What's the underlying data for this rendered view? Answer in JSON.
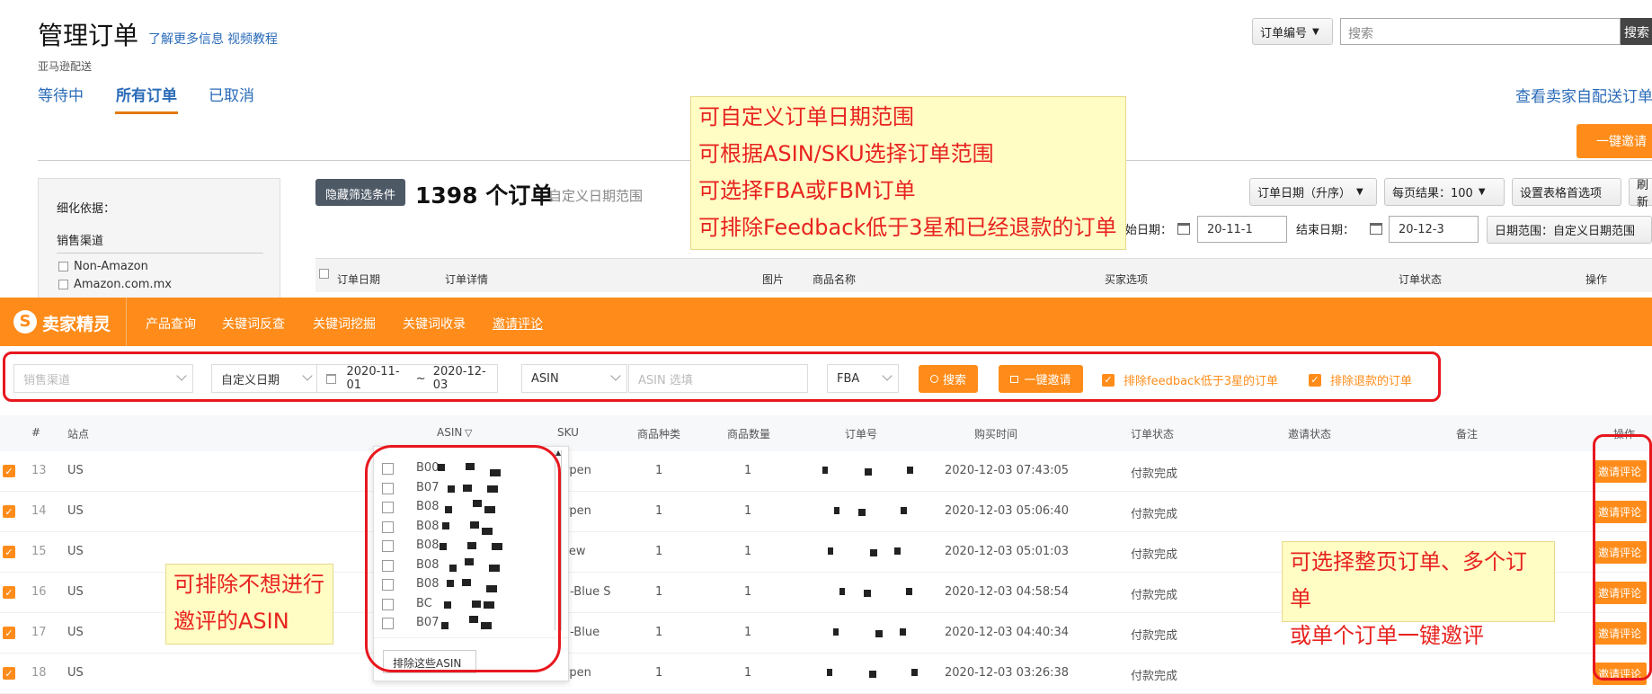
{
  "header": {
    "title": "管理订单",
    "link_more": "了解更多信息",
    "link_video": "视频教程",
    "subtitle": "亚马逊配送",
    "search_select": "订单编号",
    "search_placeholder": "搜索",
    "search_btn": "搜索",
    "seller_link": "查看卖家自配送订单",
    "one_click": "一键邀请"
  },
  "tabs": [
    {
      "label": "等待中"
    },
    {
      "label": "所有订单",
      "active": true
    },
    {
      "label": "已取消"
    }
  ],
  "sidebar": {
    "refine": "细化依据：",
    "channel": "销售渠道",
    "opt1": "Non-Amazon",
    "opt2": "Amazon.com.mx"
  },
  "toolbar": {
    "hide_filter": "隐藏筛选条件",
    "order_count": "1398 个订单",
    "date_range_hint": "自定义日期范围",
    "sort": "订单日期（升序）",
    "per_page": "每页结果：100",
    "table_pref": "设置表格首选项",
    "refresh": "刷新",
    "start_label": "始日期：",
    "start_date": "20-11-1",
    "end_label": "结束日期：",
    "end_date": "20-12-3",
    "range": "日期范围：自定义日期范围"
  },
  "amz_table_head": [
    "订单日期",
    "订单详情",
    "图片",
    "商品名称",
    "买家选项",
    "订单状态",
    "操作"
  ],
  "plugin": {
    "logo": "卖家精灵",
    "nav": [
      "产品查询",
      "关键词反查",
      "关键词挖掘",
      "关键词收录",
      "邀请评论"
    ],
    "channel_ph": "销售渠道",
    "date_type": "自定义日期",
    "date_from": "2020-11-01",
    "date_sep": "~",
    "date_to": "2020-12-03",
    "asin_sel": "ASIN",
    "asin_ph": "ASIN 选填",
    "fba": "FBA",
    "search": "搜索",
    "invite_all": "一键邀请",
    "exclude_low": "排除feedback低于3星的订单",
    "exclude_refund": "排除退款的订单"
  },
  "columns": [
    "#",
    "站点",
    "ASIN",
    "SKU",
    "商品种类",
    "商品数量",
    "订单号",
    "购买时间",
    "订单状态",
    "邀请状态",
    "备注",
    "操作"
  ],
  "rows": [
    {
      "n": "13",
      "site": "US",
      "sku": "erpen",
      "kind": "1",
      "qty": "1",
      "time": "2020-12-03 07:43:05",
      "status": "付款完成",
      "op": "邀请评论"
    },
    {
      "n": "14",
      "site": "US",
      "sku": "erpen",
      "kind": "1",
      "qty": "1",
      "time": "2020-12-03 05:06:40",
      "status": "付款完成",
      "op": "邀请评论"
    },
    {
      "n": "15",
      "site": "US",
      "sku": "-new",
      "kind": "1",
      "qty": "1",
      "time": "2020-12-03 05:01:03",
      "status": "付款完成",
      "op": "邀请评论"
    },
    {
      "n": "16",
      "site": "US",
      "sku": "QI-Blue S",
      "kind": "1",
      "qty": "1",
      "time": "2020-12-03 04:58:54",
      "status": "付款完成",
      "op": "邀请评论"
    },
    {
      "n": "17",
      "site": "US",
      "sku": "QI-Blue",
      "kind": "1",
      "qty": "1",
      "time": "2020-12-03 04:40:34",
      "status": "付款完成",
      "op": "邀请评论"
    },
    {
      "n": "18",
      "site": "US",
      "sku": "erpen",
      "kind": "1",
      "qty": "1",
      "time": "2020-12-03 03:26:38",
      "status": "付款完成",
      "op": "邀请评论"
    }
  ],
  "asin_dropdown": {
    "items": [
      "B00",
      "B07",
      "B08",
      "B08",
      "B08",
      "B08",
      "B08",
      "BC",
      "B07"
    ],
    "exclude_btn": "排除这些ASIN"
  },
  "notes": {
    "top": [
      "可自定义订单日期范围",
      "可根据ASIN/SKU选择订单范围",
      "可选择FBA或FBM订单",
      "可排除Feedback低于3星和已经退款的订单"
    ],
    "left": [
      "可排除不想进行",
      "邀评的ASIN"
    ],
    "right": [
      "可选择整页订单、多个订单",
      "或单个订单一键邀评"
    ]
  },
  "colors": {
    "accent": "#ff8c1a",
    "red": "#e8171e",
    "note_bg": "#fffcc4"
  }
}
